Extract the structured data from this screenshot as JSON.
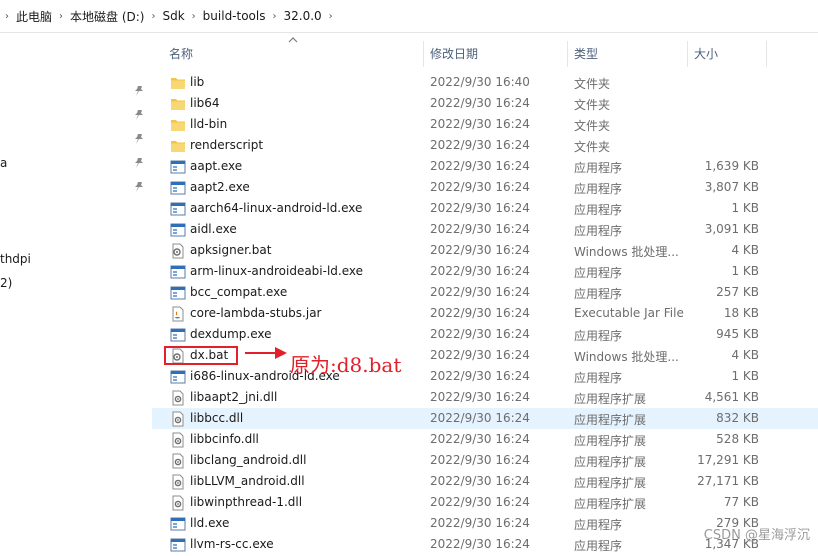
{
  "breadcrumb": [
    "此电脑",
    "本地磁盘 (D:)",
    "Sdk",
    "build-tools",
    "32.0.0"
  ],
  "nav": {
    "partial_labels": [
      "a",
      "thdpi",
      "2)"
    ]
  },
  "columns": {
    "name": "名称",
    "date": "修改日期",
    "type": "类型",
    "size": "大小"
  },
  "files": [
    {
      "name": "lib",
      "date": "2022/9/30 16:40",
      "type": "文件夹",
      "size": "",
      "icon": "folder-icon"
    },
    {
      "name": "lib64",
      "date": "2022/9/30 16:24",
      "type": "文件夹",
      "size": "",
      "icon": "folder-icon"
    },
    {
      "name": "lld-bin",
      "date": "2022/9/30 16:24",
      "type": "文件夹",
      "size": "",
      "icon": "folder-icon"
    },
    {
      "name": "renderscript",
      "date": "2022/9/30 16:24",
      "type": "文件夹",
      "size": "",
      "icon": "folder-icon"
    },
    {
      "name": "aapt.exe",
      "date": "2022/9/30 16:24",
      "type": "应用程序",
      "size": "1,639 KB",
      "icon": "exe-icon"
    },
    {
      "name": "aapt2.exe",
      "date": "2022/9/30 16:24",
      "type": "应用程序",
      "size": "3,807 KB",
      "icon": "exe-icon"
    },
    {
      "name": "aarch64-linux-android-ld.exe",
      "date": "2022/9/30 16:24",
      "type": "应用程序",
      "size": "1 KB",
      "icon": "exe-icon"
    },
    {
      "name": "aidl.exe",
      "date": "2022/9/30 16:24",
      "type": "应用程序",
      "size": "3,091 KB",
      "icon": "exe-icon"
    },
    {
      "name": "apksigner.bat",
      "date": "2022/9/30 16:24",
      "type": "Windows 批处理...",
      "size": "4 KB",
      "icon": "bat-icon"
    },
    {
      "name": "arm-linux-androideabi-ld.exe",
      "date": "2022/9/30 16:24",
      "type": "应用程序",
      "size": "1 KB",
      "icon": "exe-icon"
    },
    {
      "name": "bcc_compat.exe",
      "date": "2022/9/30 16:24",
      "type": "应用程序",
      "size": "257 KB",
      "icon": "exe-icon"
    },
    {
      "name": "core-lambda-stubs.jar",
      "date": "2022/9/30 16:24",
      "type": "Executable Jar File",
      "size": "18 KB",
      "icon": "jar-icon"
    },
    {
      "name": "dexdump.exe",
      "date": "2022/9/30 16:24",
      "type": "应用程序",
      "size": "945 KB",
      "icon": "exe-icon"
    },
    {
      "name": "dx.bat",
      "date": "2022/9/30 16:24",
      "type": "Windows 批处理...",
      "size": "4 KB",
      "icon": "bat-icon"
    },
    {
      "name": "i686-linux-android-ld.exe",
      "date": "2022/9/30 16:24",
      "type": "应用程序",
      "size": "1 KB",
      "icon": "exe-icon"
    },
    {
      "name": "libaapt2_jni.dll",
      "date": "2022/9/30 16:24",
      "type": "应用程序扩展",
      "size": "4,561 KB",
      "icon": "dll-icon"
    },
    {
      "name": "libbcc.dll",
      "date": "2022/9/30 16:24",
      "type": "应用程序扩展",
      "size": "832 KB",
      "icon": "dll-icon",
      "selected": true
    },
    {
      "name": "libbcinfo.dll",
      "date": "2022/9/30 16:24",
      "type": "应用程序扩展",
      "size": "528 KB",
      "icon": "dll-icon"
    },
    {
      "name": "libclang_android.dll",
      "date": "2022/9/30 16:24",
      "type": "应用程序扩展",
      "size": "17,291 KB",
      "icon": "dll-icon"
    },
    {
      "name": "libLLVM_android.dll",
      "date": "2022/9/30 16:24",
      "type": "应用程序扩展",
      "size": "27,171 KB",
      "icon": "dll-icon"
    },
    {
      "name": "libwinpthread-1.dll",
      "date": "2022/9/30 16:24",
      "type": "应用程序扩展",
      "size": "77 KB",
      "icon": "dll-icon"
    },
    {
      "name": "lld.exe",
      "date": "2022/9/30 16:24",
      "type": "应用程序",
      "size": "279 KB",
      "icon": "exe-icon"
    },
    {
      "name": "llvm-rs-cc.exe",
      "date": "2022/9/30 16:24",
      "type": "应用程序",
      "size": "1,347 KB",
      "icon": "exe-icon"
    }
  ],
  "annotation": {
    "text": "原为:d8.bat",
    "color": "#e0202a"
  },
  "watermark": "CSDN @星海浮沉",
  "colors": {
    "selected_row": "#e5f3ff",
    "folder": "#f5c542",
    "header_text": "#4c607a"
  }
}
